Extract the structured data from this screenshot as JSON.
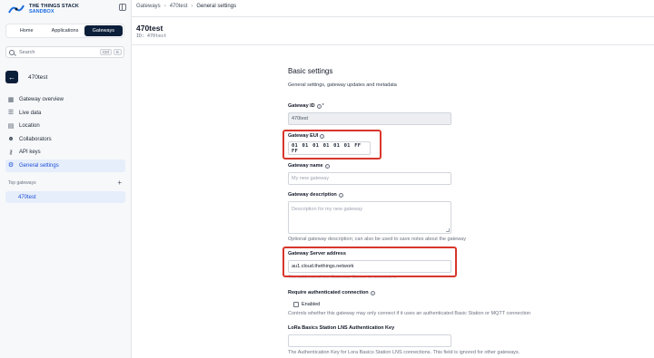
{
  "brand": {
    "line1": "THE THINGS STACK",
    "line2": "SANDBOX"
  },
  "nav_tabs": [
    "Home",
    "Applications",
    "Gateways"
  ],
  "search": {
    "placeholder": "Search",
    "key1": "Ctrl",
    "key2": "K"
  },
  "gateway_name": "470test",
  "menu": [
    {
      "label": "Gateway overview",
      "icon": "overview-icon"
    },
    {
      "label": "Live data",
      "icon": "list-icon"
    },
    {
      "label": "Location",
      "icon": "map-icon"
    },
    {
      "label": "Collaborators",
      "icon": "people-icon"
    },
    {
      "label": "API keys",
      "icon": "key-icon"
    },
    {
      "label": "General settings",
      "icon": "gear-icon"
    }
  ],
  "top_gateways": {
    "heading": "Top gateways",
    "items": [
      "470test"
    ]
  },
  "breadcrumb": [
    "Gateways",
    "470test",
    "General settings"
  ],
  "page": {
    "title": "470test",
    "id_line": "ID: 470test"
  },
  "form": {
    "section_title": "Basic settings",
    "section_subtitle": "General settings, gateway updates and metadata",
    "gateway_id_label": "Gateway ID",
    "gateway_id_value": "470test",
    "eui_label": "Gateway EUI",
    "eui_value": "01 01 01 01 01 01 FF FF",
    "name_label": "Gateway name",
    "name_placeholder": "My new gateway",
    "desc_label": "Gateway description",
    "desc_placeholder": "Description for my new gateway",
    "desc_hint": "Optional gateway description; can also be used to save notes about the gateway",
    "server_label": "Gateway Server address",
    "server_value": "au1.cloud.thethings.network",
    "server_hint": "The address of the Gateway Server to connect to",
    "auth_label": "Require authenticated connection",
    "auth_checkbox": "Enabled",
    "auth_hint": "Controls whether this gateway may only connect if it uses an authenticated Basic Station or MQTT connection",
    "lns_label": "LoRa Basics Station LNS Authentication Key",
    "lns_hint": "The Authentication Key for Lora Basics Station LNS connections. This field is ignored for other gateways."
  },
  "colors": {
    "accent": "#1d4ed8",
    "dark": "#0b1f3a",
    "highlight": "#d8362b"
  }
}
